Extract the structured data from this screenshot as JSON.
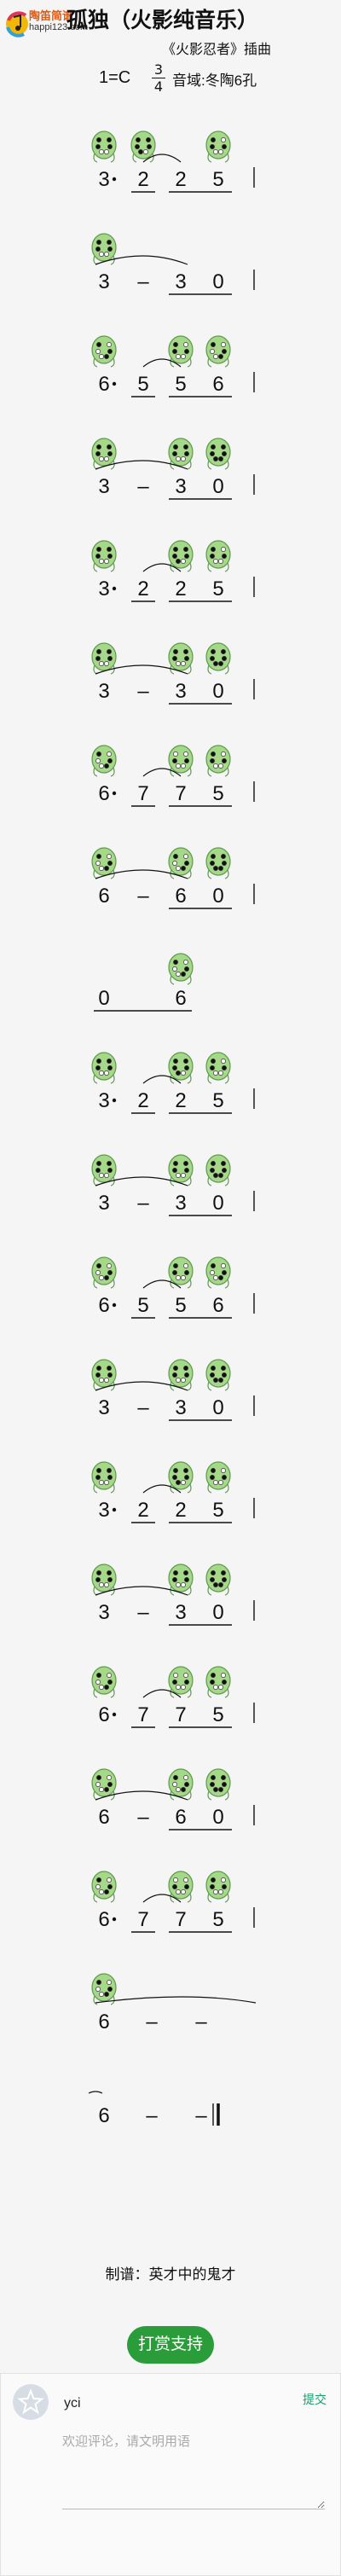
{
  "site": {
    "name": "陶笛简谱",
    "url": "happi123.com"
  },
  "song": {
    "title": "孤独（火影纯音乐）",
    "subtitle": "《火影忍者》插曲",
    "key": "1=C",
    "time_top": "3",
    "time_bottom": "4",
    "instrument": "音域:冬陶6孔"
  },
  "score": {
    "lines": [
      {
        "notes": [
          "3",
          "2",
          "2",
          "5"
        ]
      },
      {
        "notes": [
          "3",
          "–",
          "3",
          "0"
        ]
      },
      {
        "notes": [
          "6",
          "5",
          "5",
          "6"
        ]
      },
      {
        "notes": [
          "3",
          "–",
          "3",
          "0"
        ]
      },
      {
        "notes": [
          "3",
          "2",
          "2",
          "5"
        ]
      },
      {
        "notes": [
          "3",
          "–",
          "3",
          "0"
        ]
      },
      {
        "notes": [
          "6",
          "7",
          "7",
          "5"
        ]
      },
      {
        "notes": [
          "6",
          "–",
          "6",
          "0"
        ]
      },
      {
        "notes": [
          "0",
          "6"
        ]
      },
      {
        "notes": [
          "3",
          "2",
          "2",
          "5"
        ]
      },
      {
        "notes": [
          "3",
          "–",
          "3",
          "0"
        ]
      },
      {
        "notes": [
          "6",
          "5",
          "5",
          "6"
        ]
      },
      {
        "notes": [
          "3",
          "–",
          "3",
          "0"
        ]
      },
      {
        "notes": [
          "3",
          "2",
          "2",
          "5"
        ]
      },
      {
        "notes": [
          "3",
          "–",
          "3",
          "0"
        ]
      },
      {
        "notes": [
          "6",
          "7",
          "7",
          "5"
        ]
      },
      {
        "notes": [
          "6",
          "–",
          "6",
          "0"
        ]
      },
      {
        "notes": [
          "6",
          "7",
          "7",
          "5"
        ]
      },
      {
        "notes": [
          "6",
          "–",
          "–"
        ]
      },
      {
        "notes": [
          "6",
          "–",
          "–"
        ]
      }
    ]
  },
  "credit": "制谱：英才中的鬼才",
  "tip_button": "打赏支持",
  "comments": {
    "user": "yci",
    "submit_label": "提交",
    "placeholder": "欢迎评论，请文明用语"
  },
  "colors": {
    "ocarina_body": "#a6d88a",
    "ocarina_outline": "#5d9a4c",
    "hole_closed": "#111111",
    "tip_button": "#2a9d3a",
    "site_brand": "#e05a12"
  }
}
